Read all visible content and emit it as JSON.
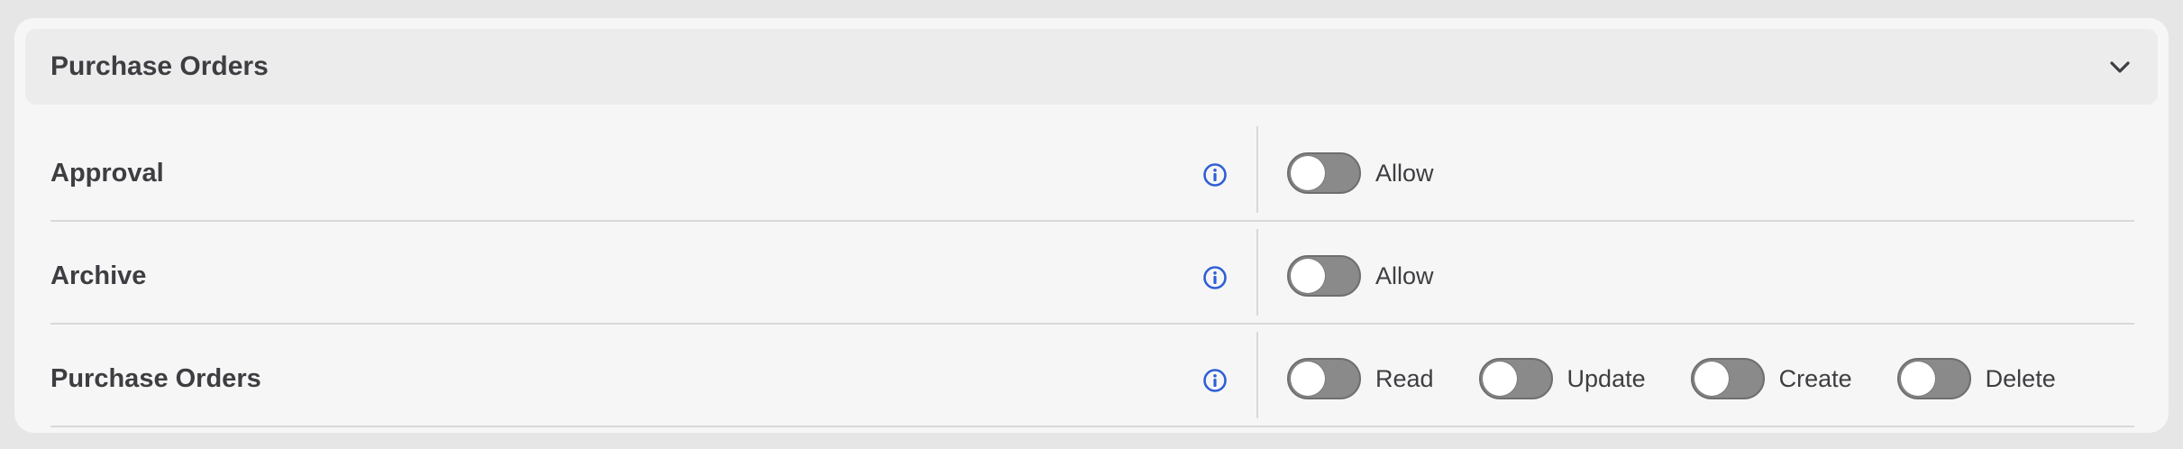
{
  "section": {
    "title": "Purchase Orders",
    "collapse_icon": "chevron-down-icon"
  },
  "rows": [
    {
      "label": "Approval",
      "info_icon": "info-icon",
      "toggles": [
        {
          "label": "Allow",
          "on": false
        }
      ]
    },
    {
      "label": "Archive",
      "info_icon": "info-icon",
      "toggles": [
        {
          "label": "Allow",
          "on": false
        }
      ]
    },
    {
      "label": "Purchase Orders",
      "info_icon": "info-icon",
      "toggles": [
        {
          "label": "Read",
          "on": false
        },
        {
          "label": "Update",
          "on": false
        },
        {
          "label": "Create",
          "on": false
        },
        {
          "label": "Delete",
          "on": false
        }
      ]
    }
  ],
  "colors": {
    "info_accent": "#2f5fd6",
    "toggle_off_track": "#8a8a8a",
    "text": "#3e3e42"
  }
}
